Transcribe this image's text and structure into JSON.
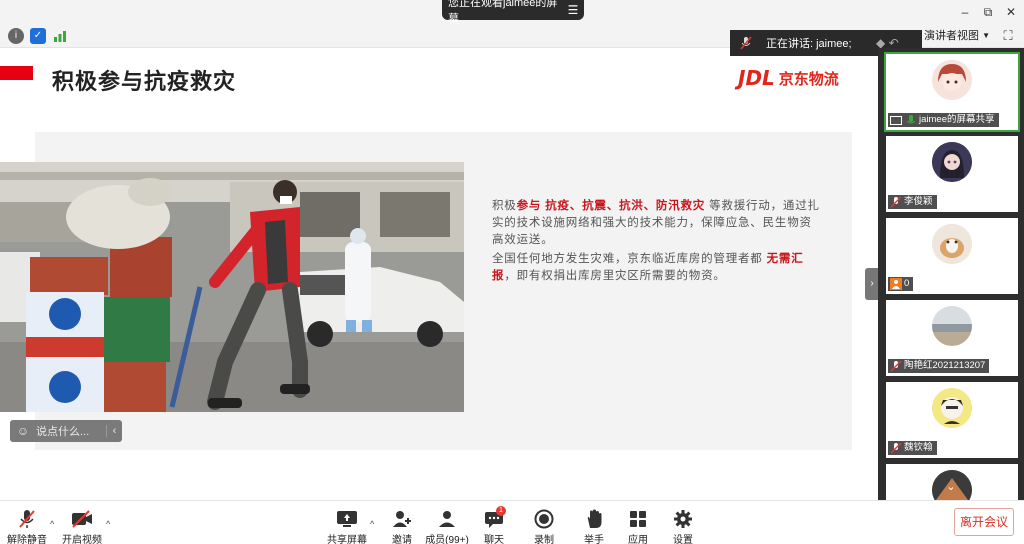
{
  "window": {
    "sharing_banner": "您正在观看jaimee的屏幕",
    "controls": {
      "minimize": "–",
      "restore": "⧉",
      "close": "✕"
    }
  },
  "infobar": {
    "view_select": "演讲者视图",
    "speaking_label": "正在讲话: jaimee;"
  },
  "slide": {
    "title": "积极参与抗疫救灾",
    "logo_mark": "JDL",
    "logo_text": "京东物流",
    "paragraph1_a": "积极",
    "paragraph1_em": "参与 抗疫、抗震、抗洪、防汛救灾",
    "paragraph1_b": "等救援行动，通过扎实的技术设施网络和强大的技术能力，保障应急、民生物资高效运送。",
    "paragraph2_a": "全国任何地方发生灾难，京东临近库房的管理者都",
    "paragraph2_em": "无需汇报",
    "paragraph2_b": "，即有权捐出库房里灾区所需要的物资。"
  },
  "chat_input": {
    "placeholder": "说点什么..."
  },
  "participants": [
    {
      "name": "jaimee的屏幕共享",
      "active": true,
      "kind": "share"
    },
    {
      "name": "李俊颖",
      "active": false,
      "kind": "mic"
    },
    {
      "name": "0",
      "active": false,
      "kind": "person"
    },
    {
      "name": "陶艳红2021213207",
      "active": false,
      "kind": "mic"
    },
    {
      "name": "魏钦翰",
      "active": false,
      "kind": "mic"
    },
    {
      "name": "",
      "active": false,
      "kind": "mic"
    }
  ],
  "toolbar": {
    "mute": "解除静音",
    "video": "开启视频",
    "share": "共享屏幕",
    "invite": "邀请",
    "members": "成员(99+)",
    "chat": "聊天",
    "chat_badge": "1",
    "record": "录制",
    "raise_hand": "举手",
    "apps": "应用",
    "settings": "设置",
    "end": "离开会议"
  },
  "colors": {
    "accent_red": "#e60012",
    "active_green": "#3ea63e",
    "sidebar_bg": "#2e2e2e"
  }
}
